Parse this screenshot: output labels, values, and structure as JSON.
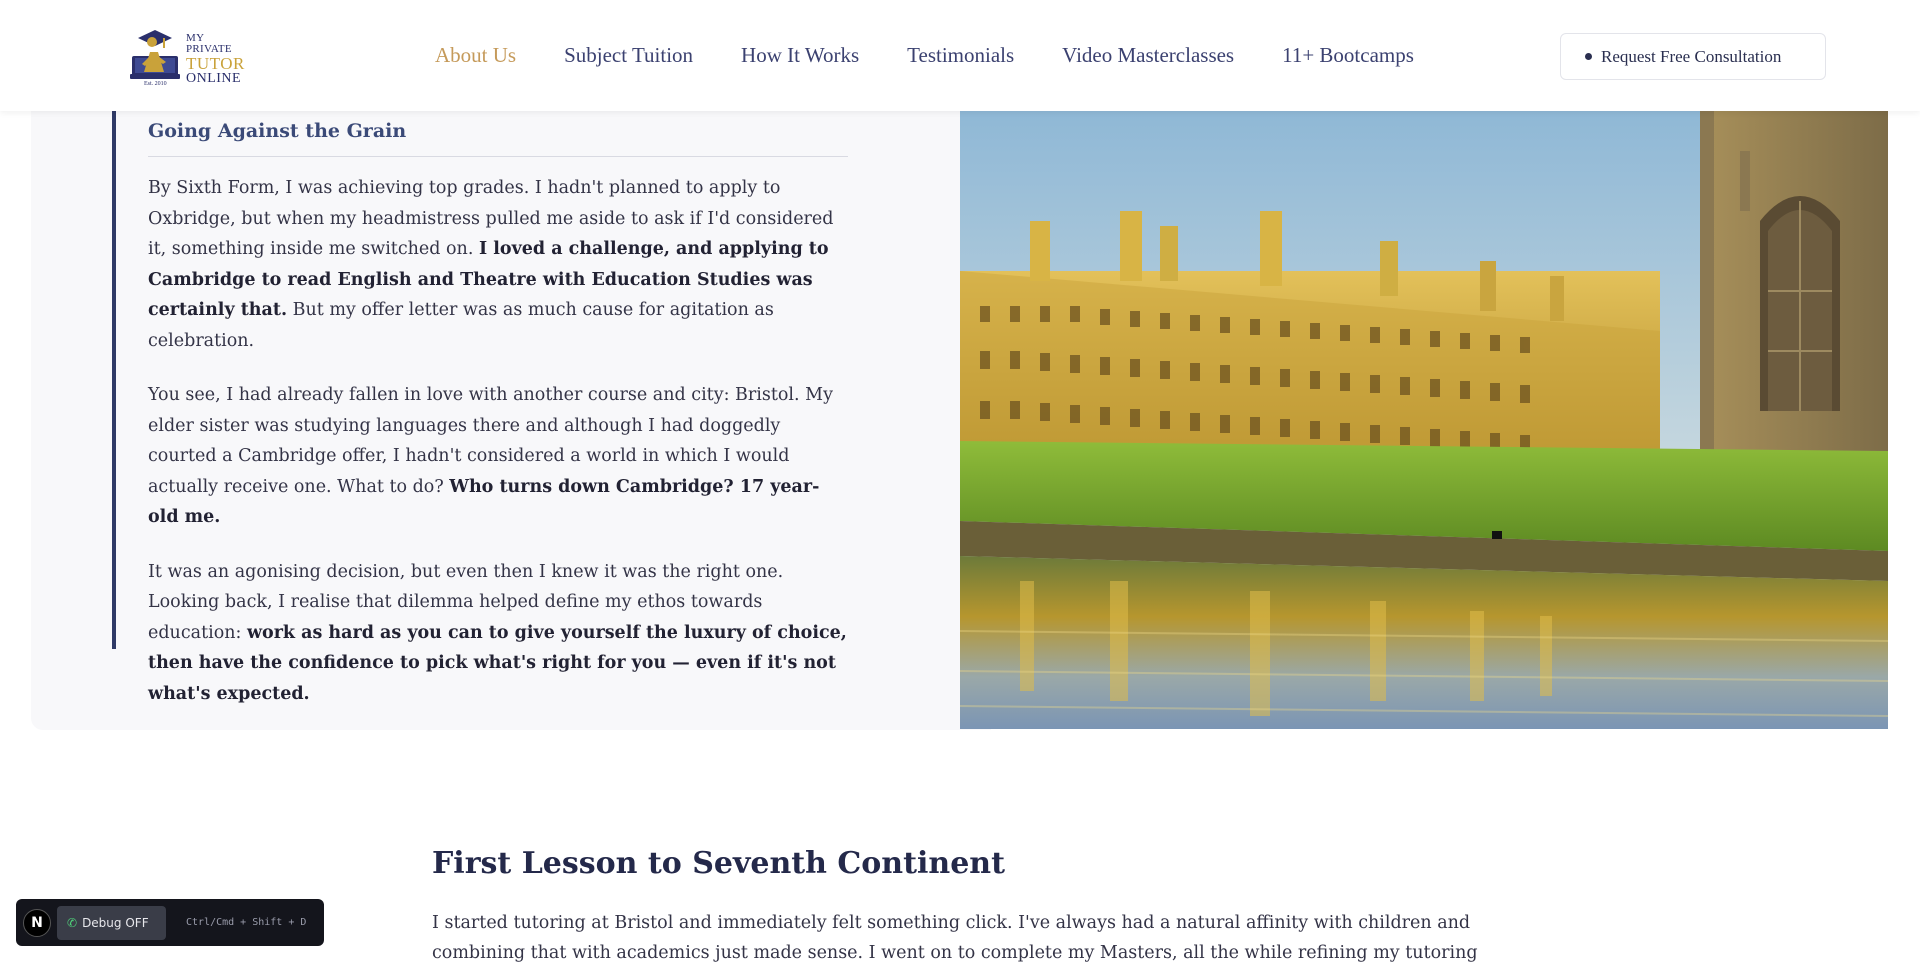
{
  "header": {
    "logo": {
      "line1": "MY PRIVATE",
      "line2": "TUTOR",
      "line3": "ONLINE",
      "est": "Est. 2010",
      "icon": "tutor-logo-icon"
    },
    "nav": [
      {
        "label": "About Us",
        "active": true
      },
      {
        "label": "Subject Tuition",
        "active": false
      },
      {
        "label": "How It Works",
        "active": false
      },
      {
        "label": "Testimonials",
        "active": false
      },
      {
        "label": "Video Masterclasses",
        "active": false
      },
      {
        "label": "11+ Bootcamps",
        "active": false
      }
    ],
    "cta_label": "Request Free Consultation"
  },
  "story": {
    "title": "Going Against the Grain",
    "paragraphs": [
      [
        {
          "text": "By Sixth Form, I was achieving top grades. I hadn't planned to apply to Oxbridge, but when my headmistress pulled me aside to ask if I'd considered it, something inside me switched on. ",
          "bold": false
        },
        {
          "text": "I loved a challenge, and applying to Cambridge to read English and Theatre with Education Studies was certainly that.",
          "bold": true
        },
        {
          "text": " But my offer letter was as much cause for agitation as celebration.",
          "bold": false
        }
      ],
      [
        {
          "text": "You see, I had already fallen in love with another course and city: Bristol. My elder sister was studying languages there and although I had doggedly courted a Cambridge offer, I hadn't considered a world in which I would actually receive one. What to do? ",
          "bold": false
        },
        {
          "text": "Who turns down Cambridge? 17 year-old me.",
          "bold": true
        }
      ],
      [
        {
          "text": "It was an agonising decision, but even then I knew it was the right one. Looking back, I realise that dilemma helped define my ethos towards education: ",
          "bold": false
        },
        {
          "text": "work as hard as you can to give yourself the luxury of choice, then have the confidence to pick what's right for you — even if it's not what's expected.",
          "bold": true
        }
      ]
    ],
    "image_subject": "King's College Cambridge by the river"
  },
  "section2": {
    "title": "First Lesson to Seventh Continent",
    "body": "I started tutoring at Bristol and immediately felt something click. I've always had a natural affinity with children and combining that with academics just made sense. I went on to complete my Masters, all the while refining my tutoring practice,"
  },
  "debug": {
    "logo_letter": "N",
    "button_label": "Debug OFF",
    "hint": "Ctrl/Cmd + Shift + D"
  },
  "colors": {
    "brand_navy": "#2a2f6b",
    "brand_gold": "#c9a23a",
    "nav_active": "#c59a5a",
    "accent_bar": "#2f3a66"
  }
}
